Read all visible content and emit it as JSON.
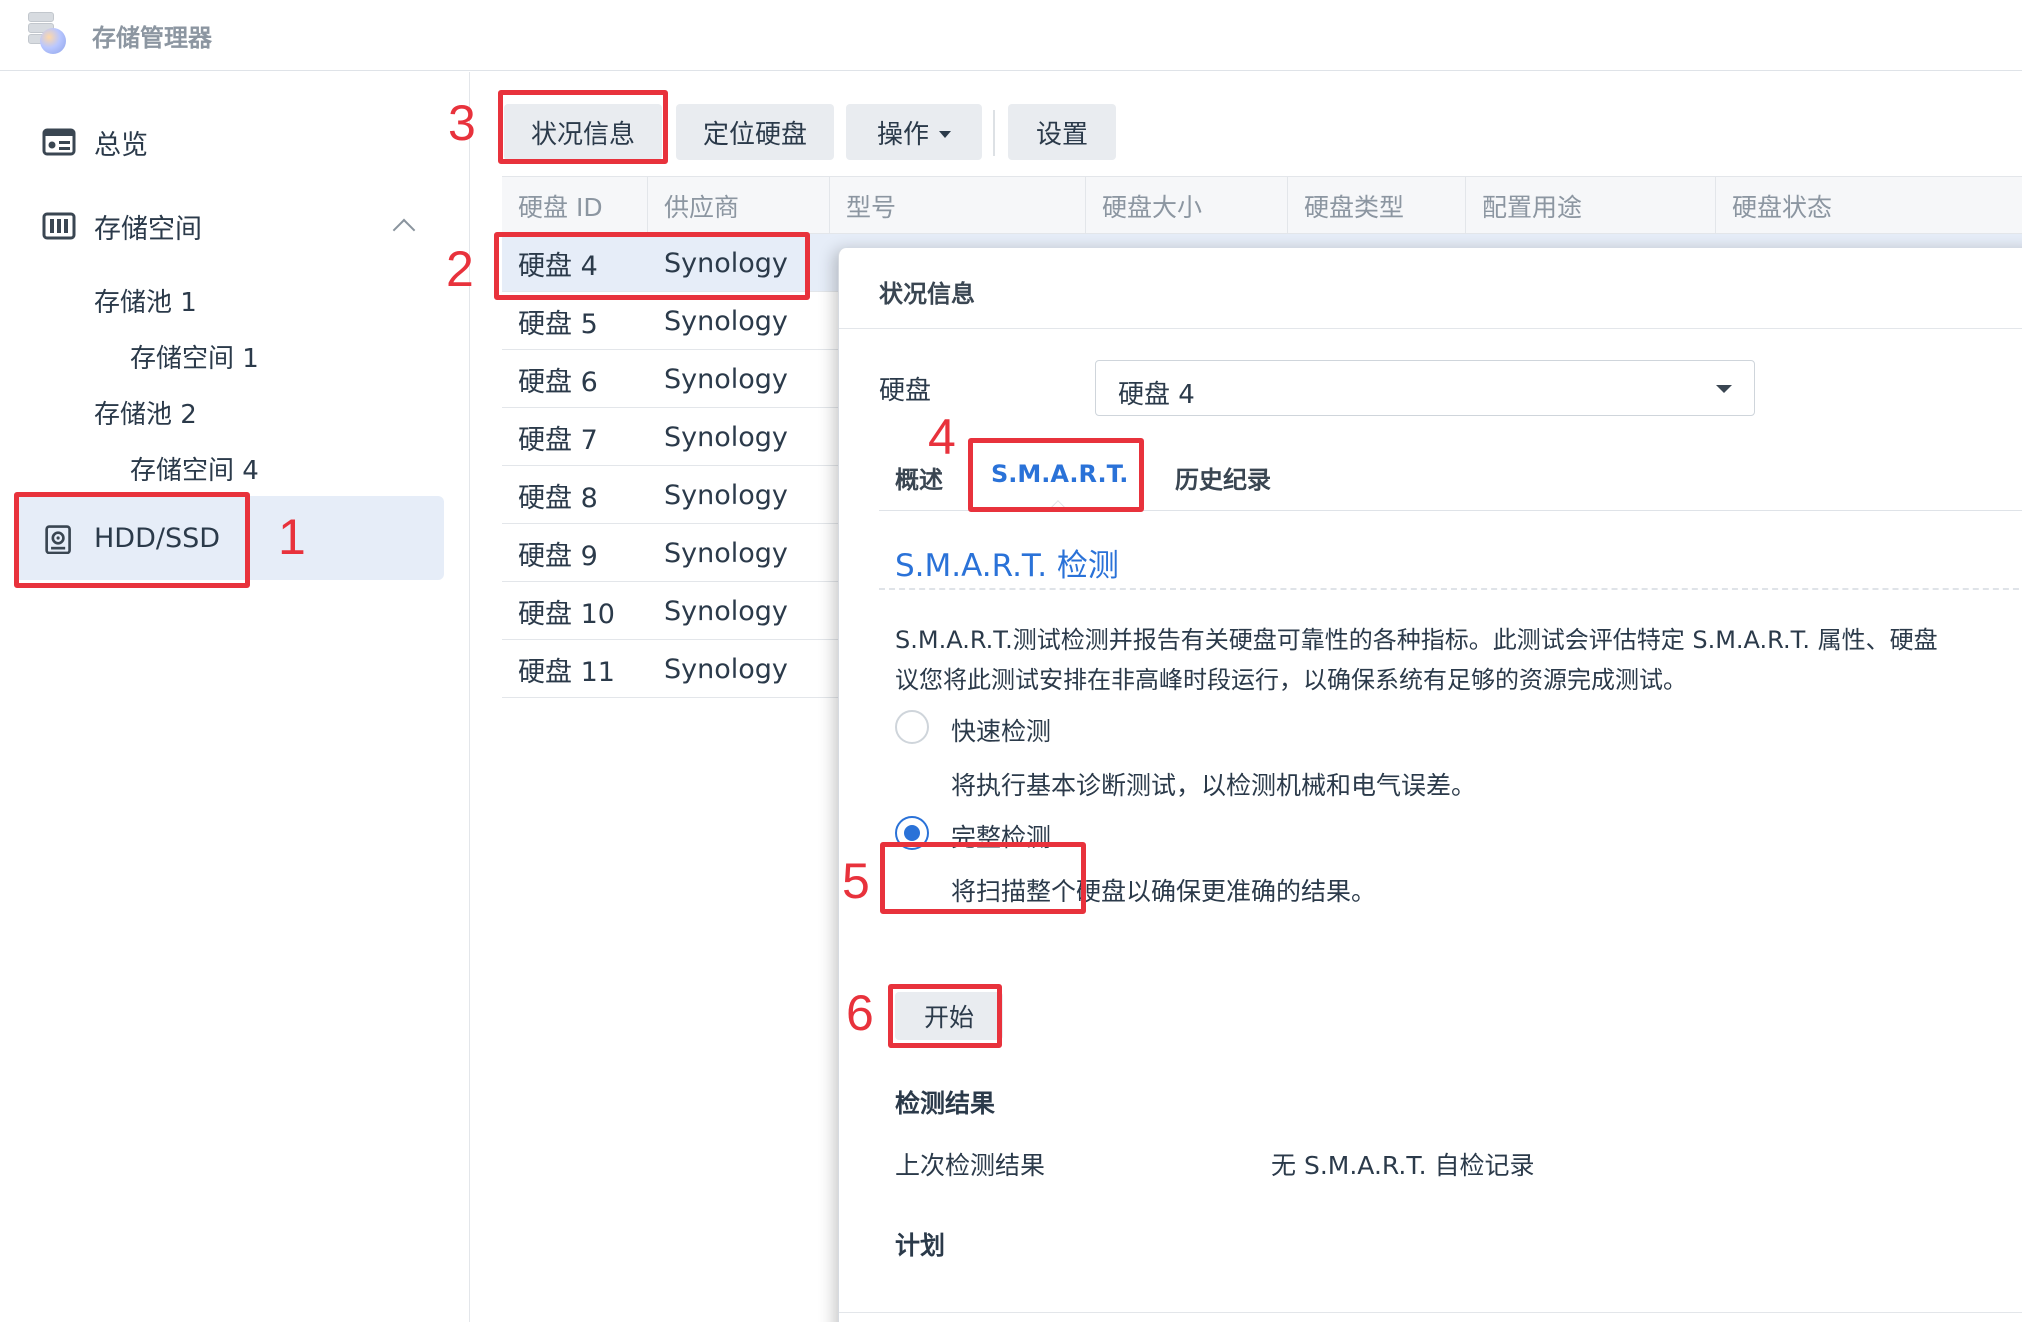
{
  "app": {
    "title": "存储管理器"
  },
  "sidebar": {
    "items": [
      {
        "label": "总览"
      },
      {
        "label": "存储空间"
      },
      {
        "label": "存储池 1"
      },
      {
        "label": "存储空间 1"
      },
      {
        "label": "存储池 2"
      },
      {
        "label": "存储空间 4"
      },
      {
        "label": "HDD/SSD"
      }
    ]
  },
  "toolbar": {
    "status_info": "状况信息",
    "locate_disk": "定位硬盘",
    "actions": "操作",
    "settings": "设置"
  },
  "table": {
    "columns": [
      "硬盘 ID",
      "供应商",
      "型号",
      "硬盘大小",
      "硬盘类型",
      "配置用途",
      "硬盘状态"
    ],
    "rows": [
      {
        "id": "硬盘 4",
        "vendor": "Synology"
      },
      {
        "id": "硬盘 5",
        "vendor": "Synology"
      },
      {
        "id": "硬盘 6",
        "vendor": "Synology"
      },
      {
        "id": "硬盘 7",
        "vendor": "Synology"
      },
      {
        "id": "硬盘 8",
        "vendor": "Synology"
      },
      {
        "id": "硬盘 9",
        "vendor": "Synology"
      },
      {
        "id": "硬盘 10",
        "vendor": "Synology"
      },
      {
        "id": "硬盘 11",
        "vendor": "Synology"
      }
    ]
  },
  "dialog": {
    "title": "状况信息",
    "disk_label": "硬盘",
    "disk_selected": "硬盘 4",
    "tabs": [
      "概述",
      "S.M.A.R.T.",
      "历史纪录"
    ],
    "active_tab": "S.M.A.R.T.",
    "section_title": "S.M.A.R.T. 检测",
    "description_line1": "S.M.A.R.T.测试检测并报告有关硬盘可靠性的各种指标。此测试会评估特定 S.M.A.R.T. 属性、硬盘",
    "description_line2": "议您将此测试安排在非高峰时段运行，以确保系统有足够的资源完成测试。",
    "quick_test_label": "快速检测",
    "quick_test_desc": "将执行基本诊断测试，以检测机械和电气误差。",
    "full_test_label": "完整检测",
    "full_test_desc": "将扫描整个硬盘以确保更准确的结果。",
    "selected_test": "完整检测",
    "start_button": "开始",
    "results_heading": "检测结果",
    "last_result_key": "上次检测结果",
    "last_result_value": "无 S.M.A.R.T. 自检记录",
    "schedule_heading": "计划"
  },
  "annotations": [
    "1",
    "2",
    "3",
    "4",
    "5",
    "6"
  ],
  "colors": {
    "accent": "#2a72d8",
    "annotation": "#e8323c",
    "selection": "#e6edf8"
  },
  "icons": [
    "storage-manager-app-icon",
    "overview-icon",
    "storage-icon",
    "hdd-icon",
    "chevron-up-icon",
    "dropdown-caret-icon"
  ]
}
